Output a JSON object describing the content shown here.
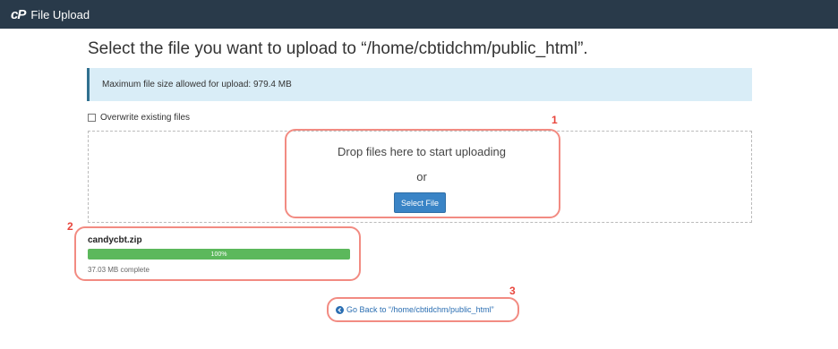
{
  "header": {
    "logo": "cP",
    "title": "File Upload"
  },
  "page": {
    "heading": "Select the file you want to upload to “/home/cbtidchm/public_html”."
  },
  "alert": {
    "text": "Maximum file size allowed for upload: 979.4 MB"
  },
  "overwrite": {
    "label": "Overwrite existing files",
    "checked": false
  },
  "dropzone": {
    "prompt": "Drop files here to start uploading",
    "or": "or",
    "button": "Select File"
  },
  "upload": {
    "filename": "candycbt.zip",
    "progress_label": "100%",
    "progress_fraction": 1.0,
    "status": "37.03 MB complete"
  },
  "go_back": {
    "label": "Go Back to “/home/cbtidchm/public_html”"
  },
  "annotations": {
    "one": "1",
    "two": "2",
    "three": "3"
  },
  "colors": {
    "topbar": "#293a4a",
    "accent": "#3a84c6",
    "progress": "#5cb85c",
    "annotation": "#f28b82"
  }
}
